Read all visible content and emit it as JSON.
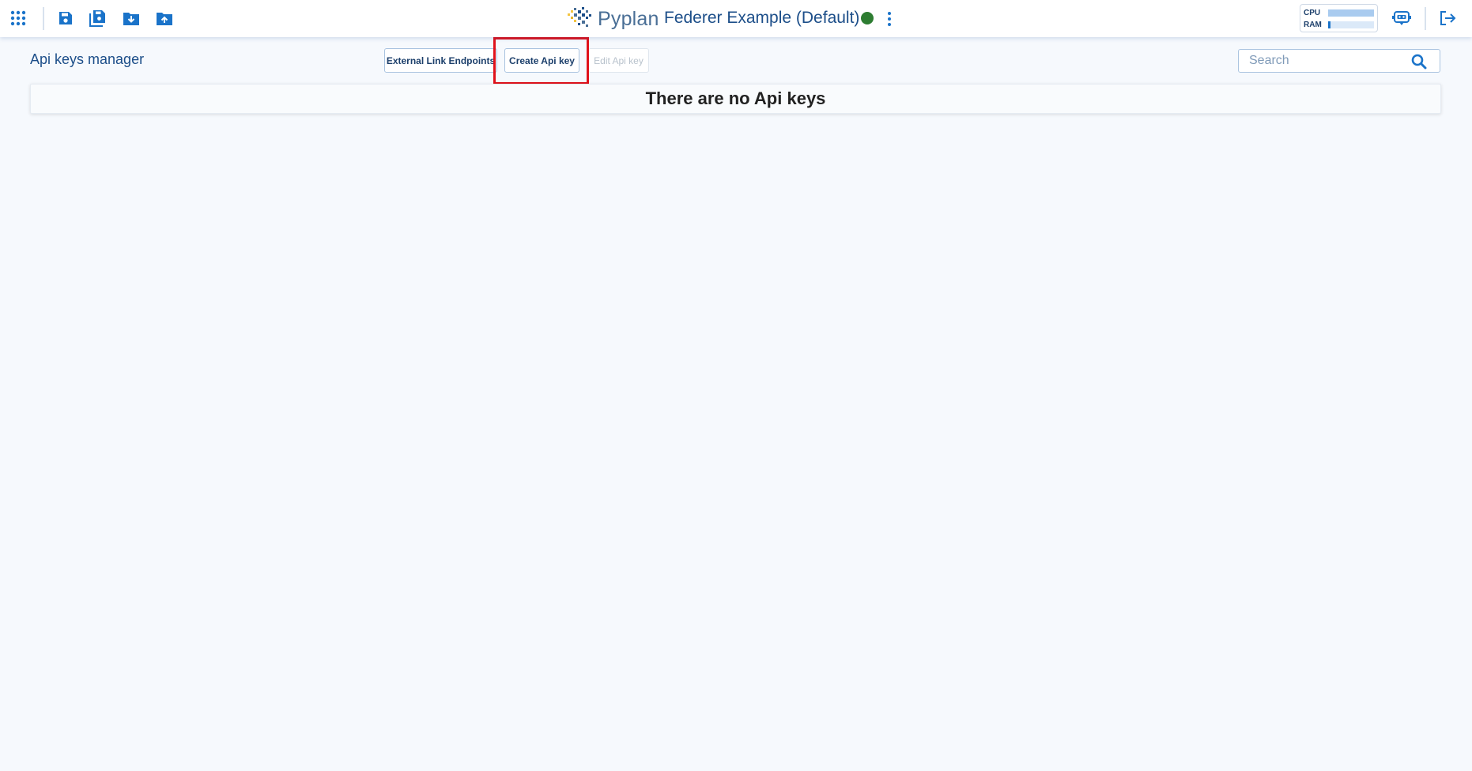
{
  "header": {
    "brand": "Pyplan",
    "app_title": "Federer Example (Default)",
    "status_color": "#2e7d32",
    "accent_color": "#1a73c9",
    "icons": {
      "apps": "grid-icon",
      "save": "save-icon",
      "save_as": "save-as-icon",
      "download": "download-icon",
      "upload": "upload-icon",
      "more": "kebab-menu-icon",
      "assistant": "chat-bot-icon",
      "logout": "logout-icon"
    },
    "resources": {
      "cpu_label": "CPU",
      "ram_label": "RAM",
      "cpu_usage": 1.0,
      "ram_usage": 0.05
    }
  },
  "page": {
    "title": "Api keys manager",
    "buttons": {
      "external_links": "External Link Endpoints",
      "create": "Create Api key",
      "edit": "Edit Api key"
    },
    "search": {
      "placeholder": "Search",
      "value": ""
    },
    "empty_message": "There are no Api keys"
  }
}
